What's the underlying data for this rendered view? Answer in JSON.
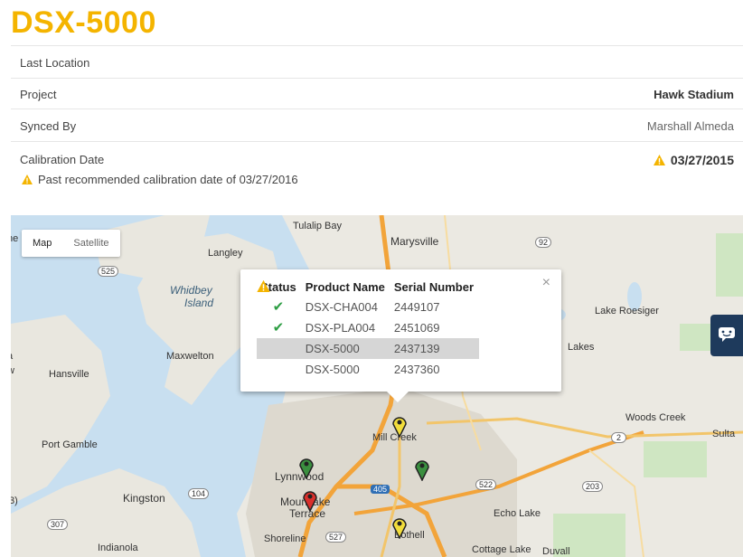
{
  "header": {
    "title": "DSX-5000"
  },
  "details": {
    "last_location_label": "Last Location",
    "project_label": "Project",
    "project_value": "Hawk Stadium",
    "synced_by_label": "Synced By",
    "synced_by_value": "Marshall Almeda",
    "calibration_label": "Calibration Date",
    "calibration_value": "03/27/2015",
    "calibration_warning": "Past recommended calibration date of 03/27/2016"
  },
  "colors": {
    "title": "#f4b400",
    "warning": "#f4b400",
    "ok": "#2e9e44",
    "marker_green": "#3a8f3f",
    "marker_yellow": "#f2dd3b",
    "marker_red": "#d9302c",
    "chat_button": "#1e3a5c"
  },
  "map": {
    "controls": {
      "map_label": "Map",
      "satellite_label": "Satellite"
    },
    "labels": {
      "tulalip_bay": "Tulalip Bay",
      "marysville": "Marysville",
      "langley": "Langley",
      "whidbey": "Whidbey",
      "island": "Island",
      "maxwelton": "Maxwelton",
      "hansville": "Hansville",
      "lake_roesiger": "Lake Roesiger",
      "lakes": "Lakes",
      "woods_creek": "Woods Creek",
      "sultan": "Sulta",
      "port_gamble": "Port Gamble",
      "mill_creek": "Mill Creek",
      "lynnwood": "Lynnwood",
      "kingston": "Kingston",
      "mountlake_terrace_1": "Mountlake",
      "mountlake_terrace_2": "Terrace",
      "echo_lake": "Echo Lake",
      "shoreline": "Shoreline",
      "bothell": "Bothell",
      "indianola": "Indianola",
      "cottage_lake": "Cottage Lake",
      "duvall": "Duvall",
      "edge_ne": "ne",
      "edge_a": "a",
      "edge_w": "w",
      "edge_3": "3)",
      "route_525": "525",
      "route_92": "92",
      "route_104": "104",
      "route_307": "307",
      "route_405": "405",
      "route_522": "522",
      "route_203": "203",
      "route_2": "2",
      "route_527": "527"
    },
    "popup": {
      "close_label": "×",
      "headers": {
        "status": "Status",
        "product": "Product Name",
        "serial": "Serial Number"
      },
      "rows": [
        {
          "status": "ok",
          "status_icon": "check-icon",
          "product": "DSX-CHA004",
          "serial": "2449107"
        },
        {
          "status": "ok",
          "status_icon": "check-icon",
          "product": "DSX-PLA004",
          "serial": "2451069"
        },
        {
          "status": "warning",
          "status_icon": "warning-icon",
          "product": "DSX-5000",
          "serial": "2437139"
        },
        {
          "status": "warning",
          "status_icon": "warning-icon",
          "product": "DSX-5000",
          "serial": "2437360"
        }
      ]
    },
    "markers": [
      {
        "name": "mill-creek-marker",
        "color": "yellow"
      },
      {
        "name": "lynnwood-marker",
        "color": "green"
      },
      {
        "name": "east-lynnwood-marker",
        "color": "green"
      },
      {
        "name": "mountlake-marker",
        "color": "red"
      },
      {
        "name": "bothell-marker",
        "color": "yellow"
      }
    ]
  }
}
